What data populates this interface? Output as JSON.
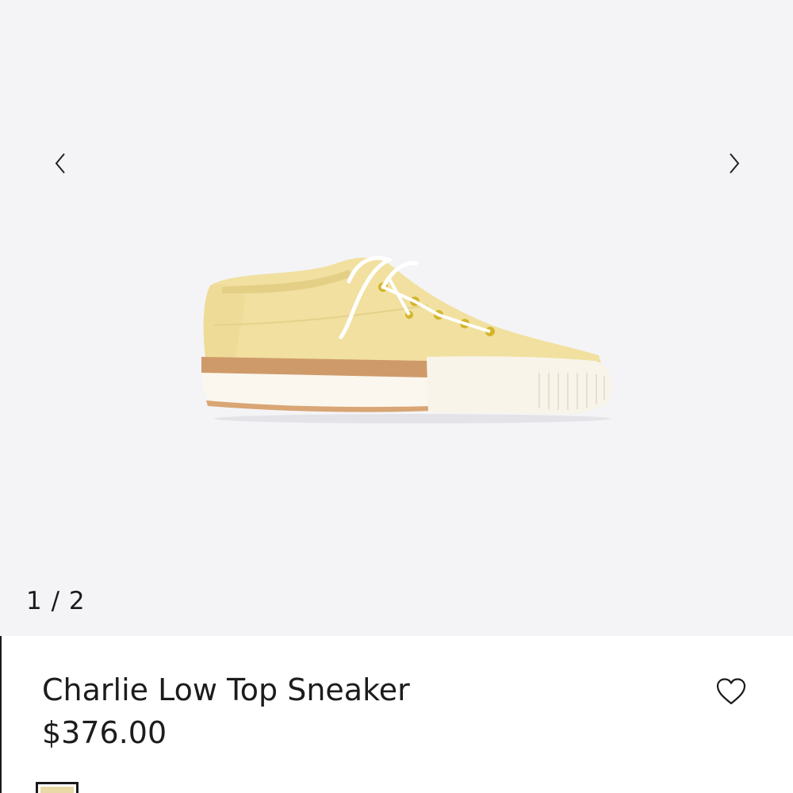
{
  "gallery": {
    "counter": "1 / 2",
    "prev_icon": "chevron-left-icon",
    "next_icon": "chevron-right-icon",
    "background": "#f4f4f7"
  },
  "product": {
    "title": "Charlie Low Top Sneaker",
    "price": "$376.00",
    "wishlist_icon": "heart-outline-icon",
    "swatch_color": "#e8d9a6"
  }
}
